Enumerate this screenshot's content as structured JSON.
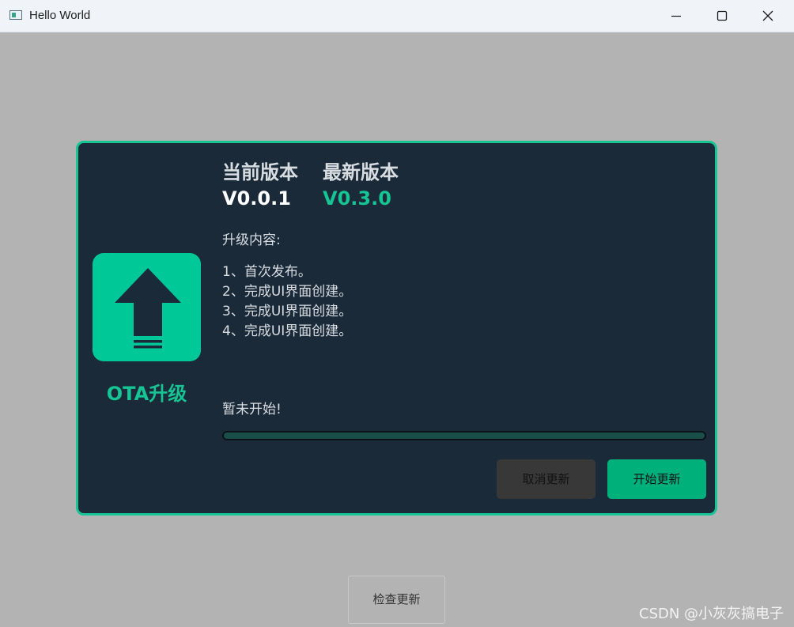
{
  "window": {
    "title": "Hello World"
  },
  "dialog": {
    "current_version_label": "当前版本",
    "latest_version_label": "最新版本",
    "current_version": "V0.0.1",
    "latest_version": "V0.3.0",
    "content_title": "升级内容:",
    "changelog": [
      "1、首次发布。",
      "2、完成UI界面创建。",
      "3、完成UI界面创建。",
      "4、完成UI界面创建。"
    ],
    "ota_label": "OTA升级",
    "status": "暂未开始!",
    "progress": 0,
    "cancel_label": "取消更新",
    "start_label": "开始更新"
  },
  "main": {
    "check_update_label": "检查更新"
  },
  "watermark": "CSDN @小灰灰搞电子",
  "colors": {
    "accent": "#16c494",
    "dialog_bg": "#1b2a39",
    "background": "#b3b3b3"
  },
  "icons": {
    "app": "app-window-icon",
    "ota": "upload-arrow-icon",
    "minimize": "minimize-icon",
    "maximize": "maximize-icon",
    "close": "close-icon"
  }
}
